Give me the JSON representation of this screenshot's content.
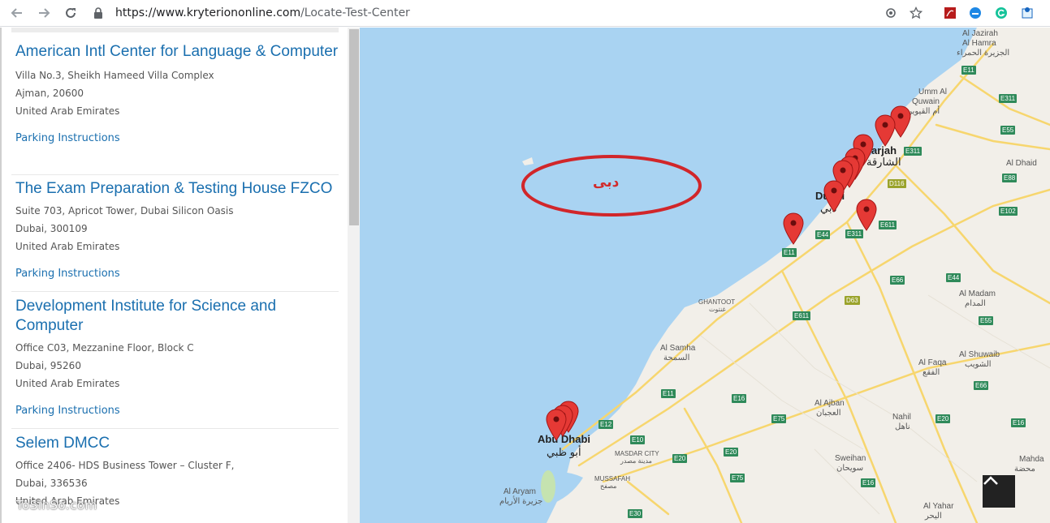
{
  "browser": {
    "url_host": "https://www.kryteriononline.com",
    "url_path": "/Locate-Test-Center"
  },
  "centers": [
    {
      "name": "American Intl Center for Language & Computer",
      "address_line": "Villa No.3, Sheikh Hameed Villa Complex",
      "city": "Ajman, 20600",
      "country": "United Arab Emirates",
      "parking_label": "Parking Instructions"
    },
    {
      "name": "The Exam Preparation & Testing House FZCO",
      "address_line": "Suite 703, Apricot Tower, Dubai Silicon Oasis",
      "city": "Dubai, 300109",
      "country": "United Arab Emirates",
      "parking_label": "Parking Instructions"
    },
    {
      "name": "Development Institute for Science and Computer",
      "address_line": "Office C03, Mezzanine Floor, Block C",
      "city": "Dubai, 95260",
      "country": "United Arab Emirates",
      "parking_label": "Parking Instructions"
    },
    {
      "name": "Selem DMCC",
      "address_line": "Office 2406- HDS Business Tower – Cluster F,",
      "city": "Dubai, 336536",
      "country": "United Arab Emirates"
    }
  ],
  "watermark": "ToSinSo.com",
  "map": {
    "annotation": "دبی",
    "colors": {
      "sea": "#a9d3f2",
      "land": "#f2efe9",
      "road": "#f7d66e",
      "pin": "#e53935"
    },
    "labels": {
      "al_jazirah": "Al Jazirah",
      "al_hamra": "Al Hamra",
      "al_hamra_ar": "الجزيرة الحمراء",
      "umm_al_quwain": "Umm Al",
      "quwain": "Quwain",
      "quwain_ar": "أم القيوين",
      "sharjah": "arjah",
      "sharjah_ar": "الشارقة",
      "dubai": "Dubai",
      "dubai_ar": "دبي",
      "al_dhaid": "Al Dhaid",
      "ghantoot": "GHANTOOT",
      "ghantoot_ar": "غنتوت",
      "al_madam": "Al Madam",
      "al_madam_ar": "المدام",
      "al_samha": "Al Samha",
      "al_samha_ar": "السمحة",
      "al_faqa": "Al Faqa",
      "al_faqa_ar": "الفقع",
      "al_shuwaib": "Al Shuwaib",
      "al_shuwaib_ar": "الشويب",
      "al_ajban": "Al Ajban",
      "al_ajban_ar": "العجبان",
      "nahil": "Nahil",
      "nahil_ar": "ناهل",
      "abu_dhabi": "Abu Dhabi",
      "abu_dhabi_ar": "أبو ظبي",
      "masdar_city": "MASDAR CITY",
      "masdar_city_ar": "مدينة مصدر",
      "mussafah": "MUSSAFAH",
      "mussafah_ar": "مصفح",
      "sweihan": "Sweihan",
      "sweihan_ar": "سويحان",
      "al_aryam": "Al Aryam",
      "al_aryam_ar": "جزيرة الأريام",
      "al_yahar": "Al Yahar",
      "al_yahar_ar": "اليحر",
      "mahdab": "Mahda",
      "mahdab_ar": "محضة"
    },
    "shields": [
      "E11",
      "E311",
      "E311",
      "E55",
      "E88",
      "E102",
      "E611",
      "E44",
      "E311",
      "E11",
      "E66",
      "E44",
      "E611",
      "E55",
      "E66",
      "E11",
      "E16",
      "E75",
      "E12",
      "E10",
      "E20",
      "E20",
      "E75",
      "E16",
      "E30",
      "E20",
      "E16",
      "D116",
      "D63"
    ]
  }
}
